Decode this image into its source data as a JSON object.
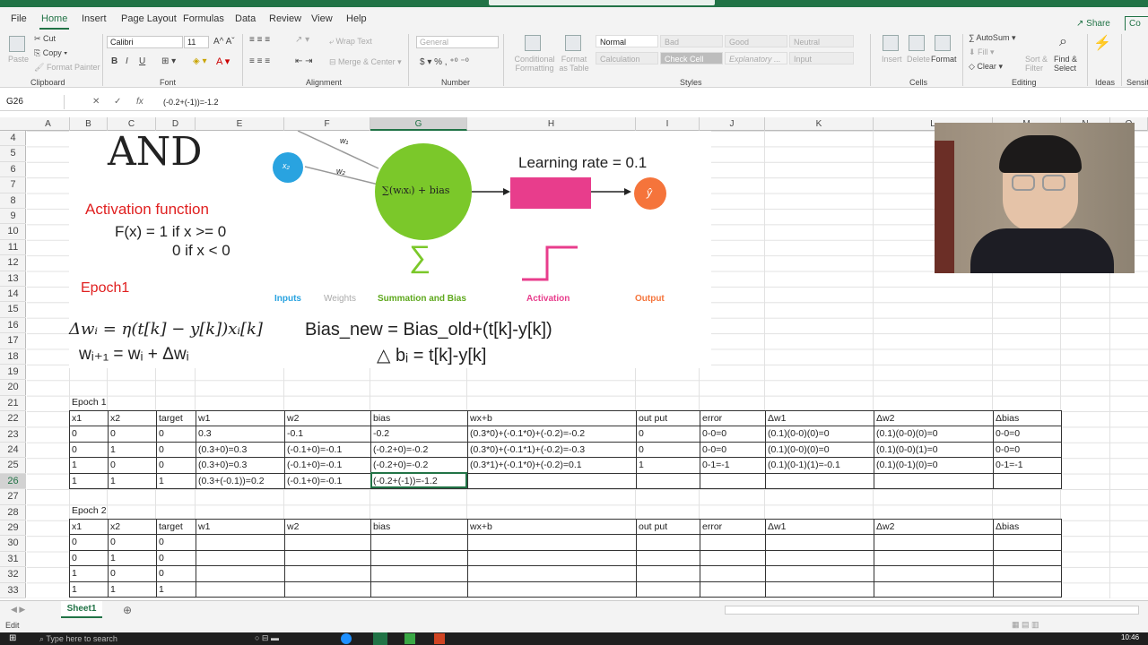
{
  "ribbon": {
    "tabs": [
      "File",
      "Home",
      "Insert",
      "Page Layout",
      "Formulas",
      "Data",
      "Review",
      "View",
      "Help"
    ],
    "share": "Share",
    "comments": "Co",
    "clipboard": {
      "paste": "Paste",
      "cut": "Cut",
      "copy": "Copy",
      "format_painter": "Format Painter",
      "label": "Clipboard"
    },
    "font": {
      "name": "Calibri",
      "size": "11",
      "label": "Font",
      "bold": "B",
      "italic": "I",
      "underline": "U"
    },
    "alignment": {
      "wrap": "Wrap Text",
      "merge": "Merge & Center",
      "label": "Alignment"
    },
    "number": {
      "format": "General",
      "label": "Number"
    },
    "styles": {
      "cond": "Conditional Formatting",
      "table": "Format as Table",
      "normal": "Normal",
      "bad": "Bad",
      "good": "Good",
      "neutral": "Neutral",
      "calculation": "Calculation",
      "check_cell": "Check Cell",
      "explanatory": "Explanatory ...",
      "input": "Input",
      "label": "Styles"
    },
    "cells": {
      "insert": "Insert",
      "delete": "Delete",
      "format": "Format",
      "label": "Cells"
    },
    "editing": {
      "autosum": "AutoSum",
      "fill": "Fill",
      "clear": "Clear",
      "sort": "Sort & Filter",
      "find": "Find & Select",
      "label": "Editing"
    },
    "ideas": {
      "label": "Ideas"
    },
    "sensitivity": "Sensiti"
  },
  "formula_bar": {
    "namebox": "G26",
    "formula": "(-0.2+(-1))=-1.2"
  },
  "columns": [
    "A",
    "B",
    "C",
    "D",
    "E",
    "F",
    "G",
    "H",
    "I",
    "J",
    "K",
    "L",
    "M",
    "N",
    "O"
  ],
  "rows": [
    "4",
    "5",
    "6",
    "7",
    "8",
    "9",
    "10",
    "11",
    "12",
    "13",
    "14",
    "15",
    "16",
    "17",
    "18",
    "19",
    "20",
    "21",
    "22",
    "23",
    "24",
    "25",
    "26",
    "27",
    "28",
    "29",
    "30",
    "31",
    "32",
    "33"
  ],
  "picture": {
    "and_title": "AND",
    "activation_function": "Activation function",
    "fx_line1": "F(x) = 1 if x >= 0",
    "fx_line2": "0 if x < 0",
    "epoch_label": "Epoch1",
    "learning_rate": "Learning rate = 0.1",
    "inputs": "Inputs",
    "weights": "Weights",
    "summation": "Summation and Bias",
    "activation": "Activation",
    "output": "Output",
    "sum_formula": "∑(wᵢxᵢ) + bias",
    "delta_w": "Δwᵢ = η(t[k] − y[k])xᵢ[k]",
    "w_update": "wᵢ₊₁ = wᵢ +  Δwᵢ",
    "bias_new": "Bias_new = Bias_old+(t[k]-y[k])",
    "delta_b": "△ bᵢ = t[k]-y[k]",
    "x2_label": "x₂",
    "w1_label": "w₁",
    "w2_label": "w₂",
    "yhat": "ŷ",
    "sigma": "∑"
  },
  "epoch1": {
    "title": "Epoch 1",
    "headers": [
      "x1",
      "x2",
      "target",
      "w1",
      "w2",
      "bias",
      "wx+b",
      "out put",
      "error",
      "Δw1",
      "Δw2",
      "Δbias"
    ],
    "rows": [
      [
        "0",
        "0",
        "0",
        "0.3",
        "-0.1",
        "-0.2",
        "(0.3*0)+(-0.1*0)+(-0.2)=-0.2",
        "0",
        "0-0=0",
        "(0.1)(0-0)(0)=0",
        "(0.1)(0-0)(0)=0",
        "0-0=0"
      ],
      [
        "0",
        "1",
        "0",
        "(0.3+0)=0.3",
        "(-0.1+0)=-0.1",
        "(-0.2+0)=-0.2",
        "(0.3*0)+(-0.1*1)+(-0.2)=-0.3",
        "0",
        "0-0=0",
        "(0.1)(0-0)(0)=0",
        "(0.1)(0-0)(1)=0",
        "0-0=0"
      ],
      [
        "1",
        "0",
        "0",
        "(0.3+0)=0.3",
        "(-0.1+0)=-0.1",
        "(-0.2+0)=-0.2",
        "(0.3*1)+(-0.1*0)+(-0.2)=0.1",
        "1",
        "0-1=-1",
        "(0.1)(0-1)(1)=-0.1",
        "(0.1)(0-1)(0)=0",
        "0-1=-1"
      ],
      [
        "1",
        "1",
        "1",
        "(0.3+(-0.1))=0.2",
        "(-0.1+0)=-0.1",
        "(-0.2+(-1))=-1.2",
        "",
        "",
        "",
        "",
        "",
        ""
      ]
    ]
  },
  "epoch2": {
    "title": "Epoch 2",
    "headers": [
      "x1",
      "x2",
      "target",
      "w1",
      "w2",
      "bias",
      "wx+b",
      "out put",
      "error",
      "Δw1",
      "Δw2",
      "Δbias"
    ],
    "rows": [
      [
        "0",
        "0",
        "0"
      ],
      [
        "0",
        "1",
        "0"
      ],
      [
        "1",
        "0",
        "0"
      ],
      [
        "1",
        "1",
        "1"
      ]
    ]
  },
  "sheet_tab": "Sheet1",
  "status": "Edit",
  "taskbar": {
    "search": "Type here to search",
    "time": "10:46"
  }
}
